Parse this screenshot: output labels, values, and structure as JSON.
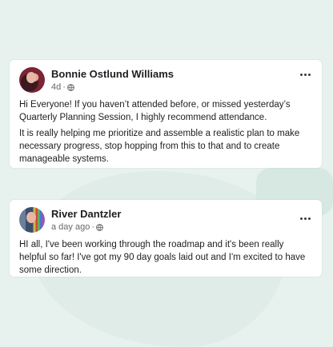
{
  "posts": [
    {
      "author": "Bonnie Ostlund Williams",
      "time": "4d",
      "paragraphs": [
        "Hi Everyone! If you haven’t attended before, or missed yesterday’s Quarterly Planning Session, I highly recommend attendance.",
        "It is really helping me prioritize and assemble a realistic plan to make necessary progress, stop hopping from this to that and to create manageable systems."
      ]
    },
    {
      "author": "River Dantzler",
      "time": "a day ago",
      "paragraphs": [
        "HI all, I've been working through the roadmap and it's been really helpful so far! I've got my 90 day goals laid out and I'm excited to have some direction."
      ]
    }
  ],
  "icons": {
    "privacy": "globe-icon",
    "menu": "more-options-icon"
  },
  "colors": {
    "background": "#e7f1ee",
    "card": "#ffffff",
    "text": "#1c1e21",
    "muted": "#65676b"
  }
}
